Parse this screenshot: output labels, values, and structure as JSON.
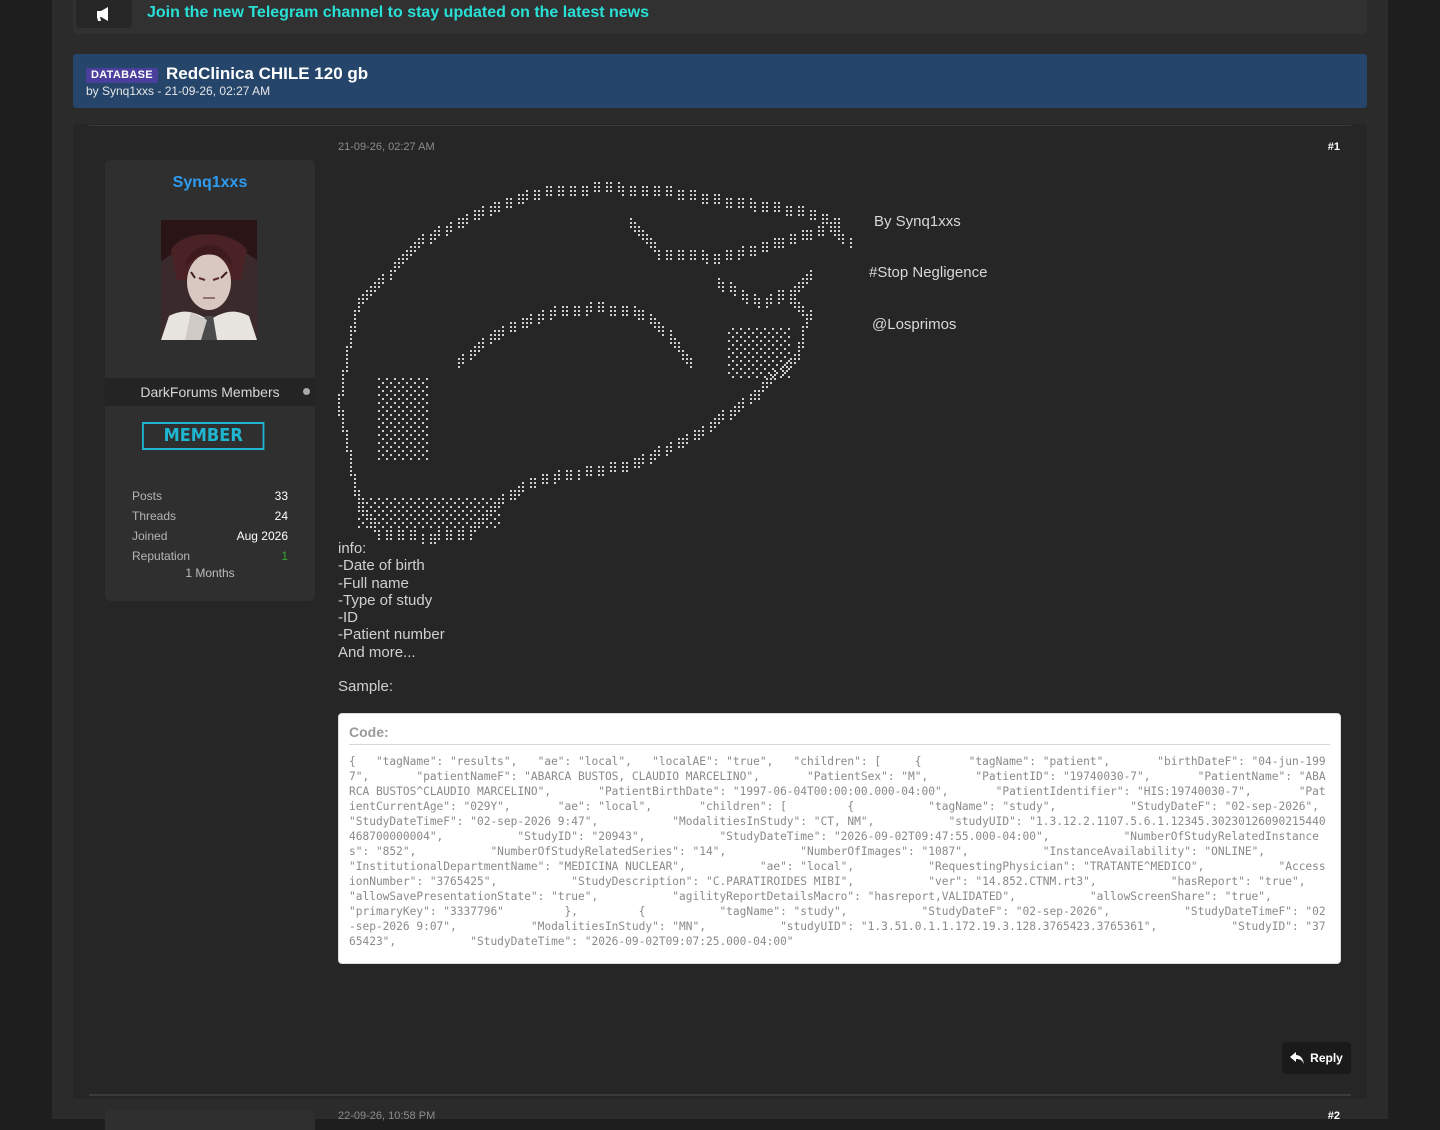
{
  "announcement": {
    "icon": "megaphone-icon",
    "text": "Join the new Telegram channel to stay updated on the latest news"
  },
  "thread": {
    "prefix": "DATABASE",
    "title": "RedClinica CHILE 120 gb",
    "meta": "by Synq1xxs - 21-09-26, 02:27 AM"
  },
  "author": {
    "name": "Synq1xxs",
    "usergroup": "DarkForums Members",
    "badge": "MEMBER",
    "stats": [
      {
        "label": "Posts",
        "value": "33"
      },
      {
        "label": "Threads",
        "value": "24"
      },
      {
        "label": "Joined",
        "value": "Aug 2026"
      },
      {
        "label": "Reputation",
        "value": "1"
      }
    ],
    "membership": "1 Months"
  },
  "post": {
    "date": "21-09-26, 02:27 AM",
    "number": "#1",
    "signature": {
      "line1": "By Synq1xxs",
      "line2": "#Stop Negligence",
      "line3": "@Losprimos"
    },
    "info_lines": [
      "info:",
      "-Date of birth",
      "-Full name",
      "-Type of study",
      "-ID",
      "-Patient number",
      "And more...",
      "",
      "Sample:"
    ],
    "code_title": "Code:",
    "code_text": "{   \"tagName\": \"results\",   \"ae\": \"local\",   \"localAE\": \"true\",   \"children\": [     {       \"tagName\": \"patient\",       \"birthDateF\": \"04-jun-1997\",       \"patientNameF\": \"ABARCA BUSTOS, CLAUDIO MARCELINO\",       \"PatientSex\": \"M\",       \"PatientID\": \"19740030-7\",       \"PatientName\": \"ABARCA BUSTOS^CLAUDIO MARCELINO\",       \"PatientBirthDate\": \"1997-06-04T00:00:00.000-04:00\",       \"PatientIdentifier\": \"HIS:19740030-7\",       \"PatientCurrentAge\": \"029Y\",       \"ae\": \"local\",       \"children\": [         {           \"tagName\": \"study\",           \"StudyDateF\": \"02-sep-2026\",           \"StudyDateTimeF\": \"02-sep-2026 9:47\",           \"ModalitiesInStudy\": \"CT, NM\",           \"studyUID\": \"1.3.12.2.1107.5.6.1.12345.30230126090215440468700000004\",           \"StudyID\": \"20943\",           \"StudyDateTime\": \"2026-09-02T09:47:55.000-04:00\",           \"NumberOfStudyRelatedInstances\": \"852\",           \"NumberOfStudyRelatedSeries\": \"14\",           \"NumberOfImages\": \"1087\",           \"InstanceAvailability\": \"ONLINE\",           \"InstitutionalDepartmentName\": \"MEDICINA NUCLEAR\",           \"ae\": \"local\",           \"RequestingPhysician\": \"TRATANTE^MEDICO\",           \"AccessionNumber\": \"3765425\",           \"StudyDescription\": \"C.PARATIROIDES MIBI\",           \"ver\": \"14.852.CTNM.rt3\",           \"hasReport\": \"true\",           \"allowSavePresentationState\": \"true\",           \"agilityReportDetailsMacro\": \"hasreport,VALIDATED\",           \"allowScreenShare\": \"true\",           \"primaryKey\": \"3337796\"         },         {           \"tagName\": \"study\",           \"StudyDateF\": \"02-sep-2026\",           \"StudyDateTimeF\": \"02-sep-2026 9:07\",           \"ModalitiesInStudy\": \"MN\",           \"studyUID\": \"1.3.51.0.1.1.172.19.3.128.3765423.3765361\",           \"StudyID\": \"3765423\",           \"StudyDateTime\": \"2026-09-02T09:07:25.000-04:00\"",
    "reply_label": "Reply"
  },
  "next_post": {
    "date": "22-09-26, 10:58 PM",
    "number": "#2"
  },
  "colors": {
    "accent_cyan": "#29e0d6",
    "thread_header": "#25456b",
    "username": "#2f9cf2",
    "badge": "#1fb6d1"
  }
}
